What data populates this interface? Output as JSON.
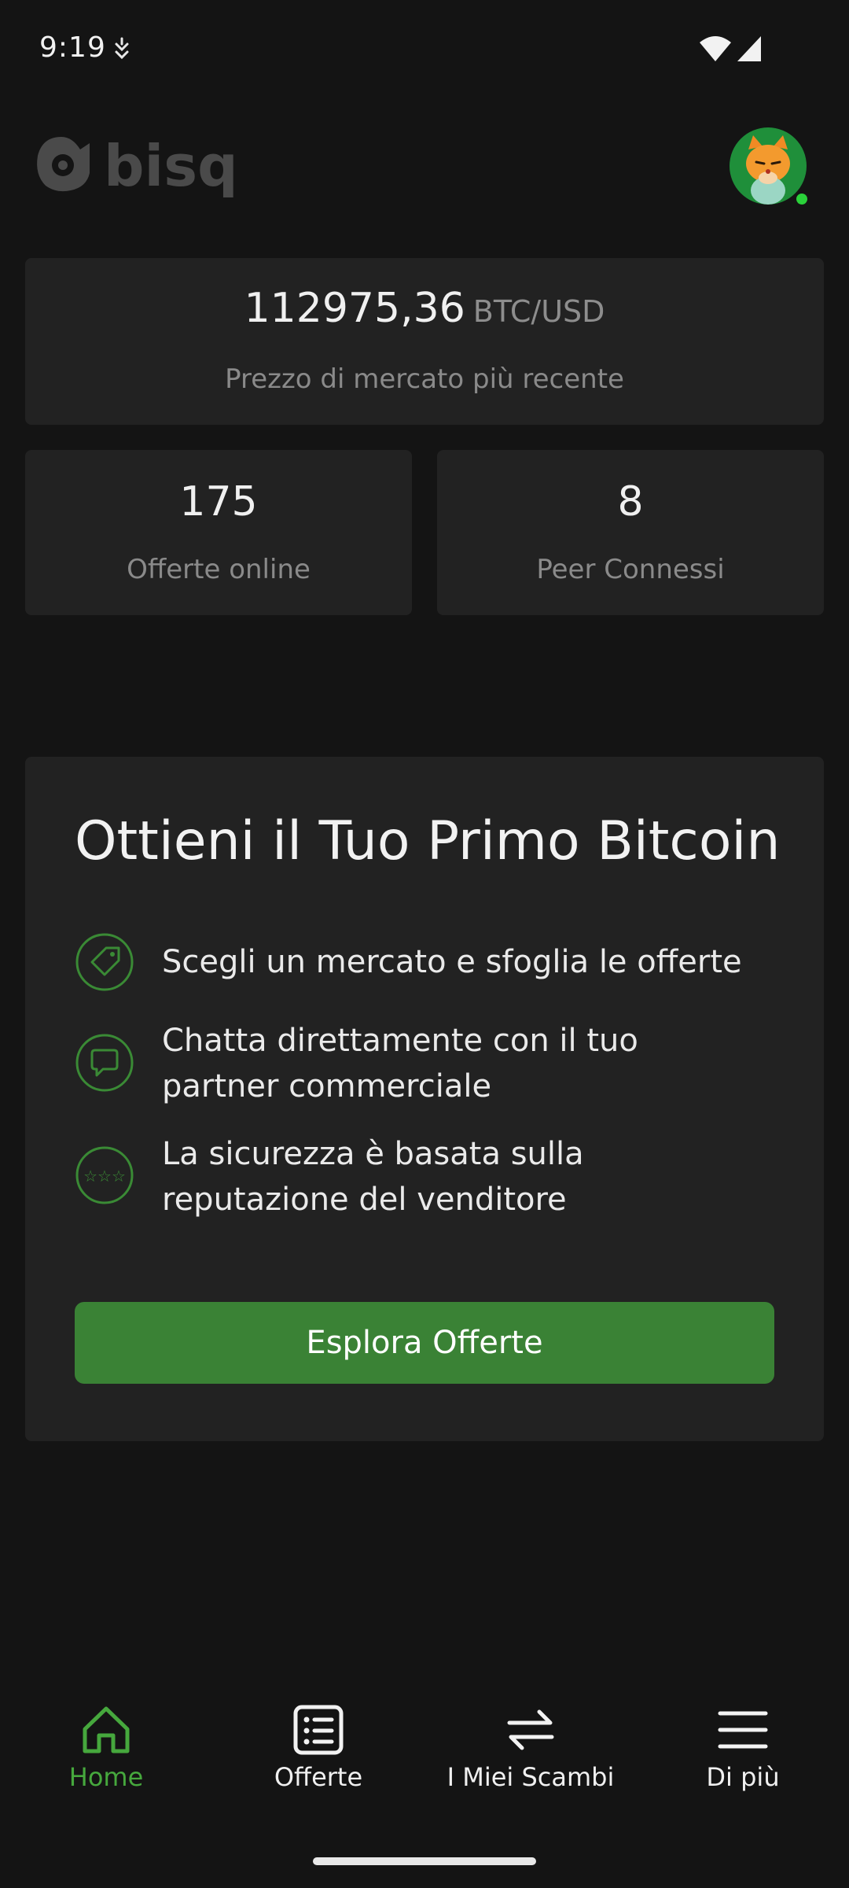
{
  "status_bar": {
    "time": "9:19"
  },
  "header": {
    "logo_text": "bisq",
    "avatar_icon": "cat-avatar-icon",
    "online_color": "#2ad13a"
  },
  "market": {
    "price": "112975,36",
    "pair": "BTC/USD",
    "caption": "Prezzo di mercato più recente"
  },
  "stats": [
    {
      "value": "175",
      "label": "Offerte online"
    },
    {
      "value": "8",
      "label": "Peer Connessi"
    }
  ],
  "promo": {
    "title": "Ottieni il Tuo Primo Bitcoin",
    "features": [
      {
        "icon": "tag-icon",
        "text": "Scegli un mercato e sfoglia le offerte"
      },
      {
        "icon": "chat-icon",
        "text": "Chatta direttamente con il tuo partner commerciale"
      },
      {
        "icon": "stars-icon",
        "text": "La sicurezza è basata sulla reputazione del venditore"
      }
    ],
    "button_label": "Esplora Offerte"
  },
  "nav": {
    "items": [
      {
        "label": "Home",
        "icon": "home-icon",
        "active": true
      },
      {
        "label": "Offerte",
        "icon": "list-icon",
        "active": false
      },
      {
        "label": "I Miei Scambi",
        "icon": "swap-icon",
        "active": false
      },
      {
        "label": "Di più",
        "icon": "menu-icon",
        "active": false
      }
    ]
  },
  "colors": {
    "background": "#141414",
    "card": "#222222",
    "accent": "#3a8235",
    "accent_text": "#46a83d"
  }
}
